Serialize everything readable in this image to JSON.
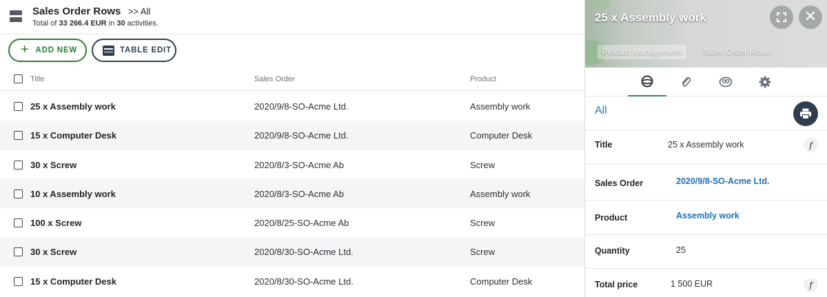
{
  "header": {
    "title": "Sales Order Rows",
    "breadcrumb": ">> All",
    "summary_prefix": "Total of",
    "summary_amount": "33 266.4 EUR",
    "summary_mid": "in",
    "summary_count": "30",
    "summary_suffix": "activities."
  },
  "toolbar": {
    "add_label": "ADD NEW",
    "table_edit_label": "TABLE EDIT"
  },
  "columns": {
    "title": "Title",
    "sales_order": "Sales Order",
    "product": "Product"
  },
  "rows": [
    {
      "title": "25 x Assembly work",
      "sales_order": "2020/9/8-SO-Acme Ltd.",
      "product": "Assembly work"
    },
    {
      "title": "15 x Computer Desk",
      "sales_order": "2020/9/8-SO-Acme Ltd.",
      "product": "Computer Desk"
    },
    {
      "title": "30 x Screw",
      "sales_order": "2020/8/3-SO-Acme Ab",
      "product": "Screw"
    },
    {
      "title": "10 x Assembly work",
      "sales_order": "2020/8/3-SO-Acme Ab",
      "product": "Assembly work"
    },
    {
      "title": "100 x Screw",
      "sales_order": "2020/8/25-SO-Acme Ab",
      "product": "Screw"
    },
    {
      "title": "30 x Screw",
      "sales_order": "2020/8/30-SO-Acme Ltd.",
      "product": "Screw"
    },
    {
      "title": "15 x Computer Desk",
      "sales_order": "2020/8/30-SO-Acme Ltd.",
      "product": "Computer Desk"
    }
  ],
  "panel": {
    "title": "25 x Assembly work",
    "tags": [
      "Product Management",
      "Sales Order Rows"
    ],
    "section": "All",
    "fields": {
      "title_label": "Title",
      "title_value": "25 x Assembly work",
      "so_label": "Sales Order",
      "so_value": "2020/9/8-SO-Acme Ltd.",
      "product_label": "Product",
      "product_value": "Assembly work",
      "qty_label": "Quantity",
      "qty_value": "25",
      "price_label": "Total price",
      "price_value": "1 500 EUR"
    },
    "fx_glyph": "f",
    "close_glyph": "✕"
  },
  "colors": {
    "accent_green": "#2e7d32",
    "dark_navy": "#2f3e4e",
    "link_blue": "#1f6fb5",
    "row_alt": "#f4f5f7"
  },
  "icons": [
    "menu-icon",
    "plus-icon",
    "table-icon",
    "expand-icon",
    "close-icon",
    "overview-icon",
    "attachment-icon",
    "link-icon",
    "gear-icon",
    "print-icon",
    "formula-icon"
  ]
}
